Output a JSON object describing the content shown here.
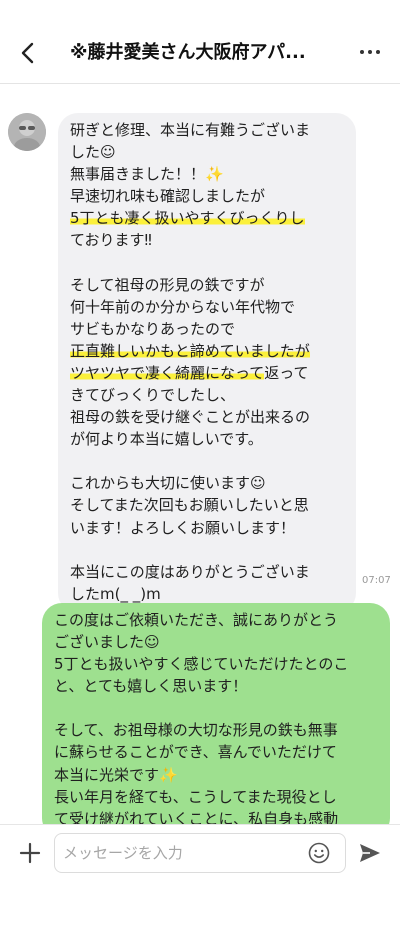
{
  "header": {
    "title": "※藤井愛美さん大阪府アパ..."
  },
  "messages": {
    "incoming": {
      "line_1": "研ぎと修理、本当に有難うございま",
      "line_2": "した☺",
      "line_3": "無事届きました！！✨",
      "line_4": "早速切れ味も確認しましたが",
      "line_5": "5丁とも凄く扱いやすくびっくりし",
      "line_6": "ております‼",
      "line_7": "そして祖母の形見の鉄ですが",
      "line_8": "何十年前のか分からない年代物で",
      "line_9": "サビもかなりあったので",
      "line_10": "正直難しいかもと諦めていましたが",
      "line_11_highlight": "ツヤツヤで凄く綺麗になって",
      "line_11_rest": "返って",
      "line_12": "きてびっくりでしたし、",
      "line_13": "祖母の鉄を受け継ぐことが出来るの",
      "line_14": "が何より本当に嬉しいです。",
      "line_15": "これからも大切に使います☺",
      "line_16": "そしてまた次回もお願いしたいと思",
      "line_17": "います！よろしくお願いします！",
      "line_18": "本当にこの度はありがとうございま",
      "line_19": "したm(_ _)m",
      "time": "07:07"
    },
    "outgoing": {
      "line_1": "この度はご依頼いただき、誠にありがとう",
      "line_2": "ございました☺",
      "line_3": "5丁とも扱いやすく感じていただけたとのこ",
      "line_4": "と、とても嬉しく思います！",
      "line_5": "そして、お祖母様の大切な形見の鉄も無事",
      "line_6": "に蘇らせることができ、喜んでいただけて",
      "line_7": "本当に光栄です✨",
      "line_8": "長い年月を経ても、こうしてまた現役とし",
      "line_9": "て受け継がれていくことに、私自身も感動"
    }
  },
  "input_bar": {
    "placeholder": "メッセージを入力"
  },
  "colors": {
    "outgoing_bubble": "#9ee08f",
    "incoming_bubble": "#f1f1f3",
    "highlight": "#fbf03b"
  },
  "icons": [
    "back-arrow-icon",
    "more-dots-icon",
    "plus-icon",
    "emoji-icon",
    "send-icon"
  ]
}
